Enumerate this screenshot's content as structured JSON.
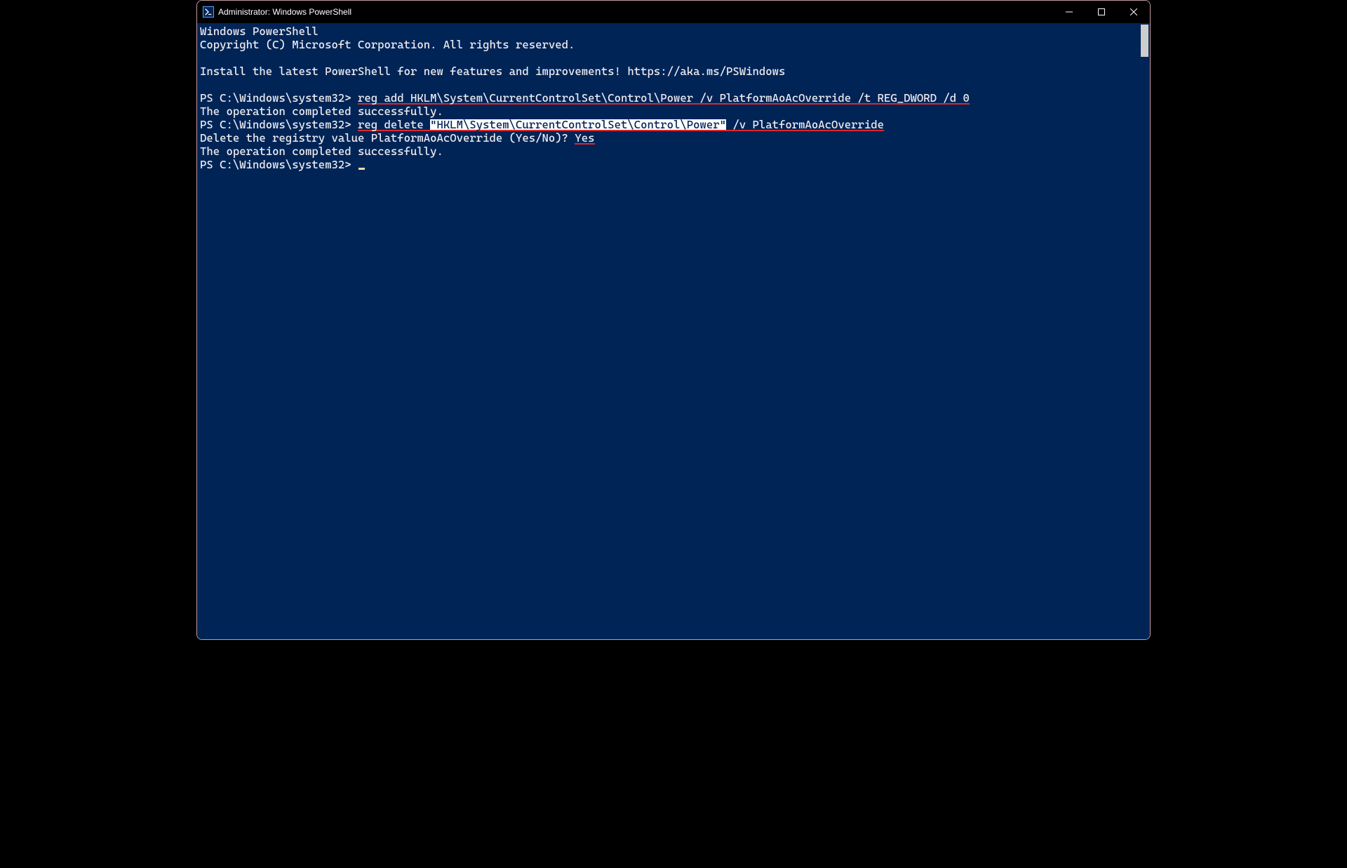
{
  "titlebar": {
    "title": "Administrator: Windows PowerShell"
  },
  "terminal": {
    "lines": {
      "l1": "Windows PowerShell",
      "l2": "Copyright (C) Microsoft Corporation. All rights reserved.",
      "l3": "",
      "l4": "Install the latest PowerShell for new features and improvements! https://aka.ms/PSWindows",
      "l5": "",
      "prompt1_prefix": "PS C:\\Windows\\system32> ",
      "cmd1_underlined": "reg add HKLM\\System\\CurrentControlSet\\Control\\Power /v PlatformAoAcOverride /t REG_DWORD /d 0",
      "l7": "The operation completed successfully.",
      "prompt2_prefix": "PS C:\\Windows\\system32> ",
      "cmd2_u1": "reg delete ",
      "cmd2_highlight": "\"HKLM\\System\\CurrentControlSet\\Control\\Power\"",
      "cmd2_u2": " /v PlatformAoAcOverride",
      "l9_prefix": "Delete the registry value PlatformAoAcOverride (Yes/No)? ",
      "l9_yes": "Yes",
      "l10": "The operation completed successfully.",
      "prompt3": "PS C:\\Windows\\system32> "
    }
  }
}
